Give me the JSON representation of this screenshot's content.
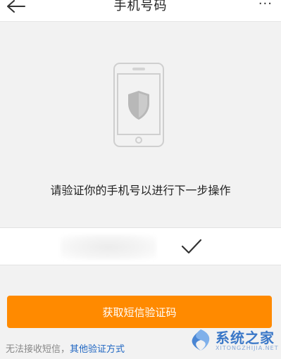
{
  "header": {
    "title": "手机号码",
    "back_icon": "arrow-left-icon",
    "more_label": "···"
  },
  "illustration": {
    "icon": "phone-shield-icon"
  },
  "prompt": "请验证你的手机号以进行下一步操作",
  "phone_input": {
    "value": ""
  },
  "confirm_icon": "checkmark-icon",
  "sms_button_label": "获取短信验证码",
  "footer": {
    "text": "无法接收短信，",
    "link": "其他验证方式"
  },
  "watermark": {
    "text": "系统之家",
    "domain": "XITONGZHIJIA.NET"
  },
  "colors": {
    "accent": "#ff8a00",
    "link": "#1f66c2",
    "background": "#f2f2f2"
  }
}
